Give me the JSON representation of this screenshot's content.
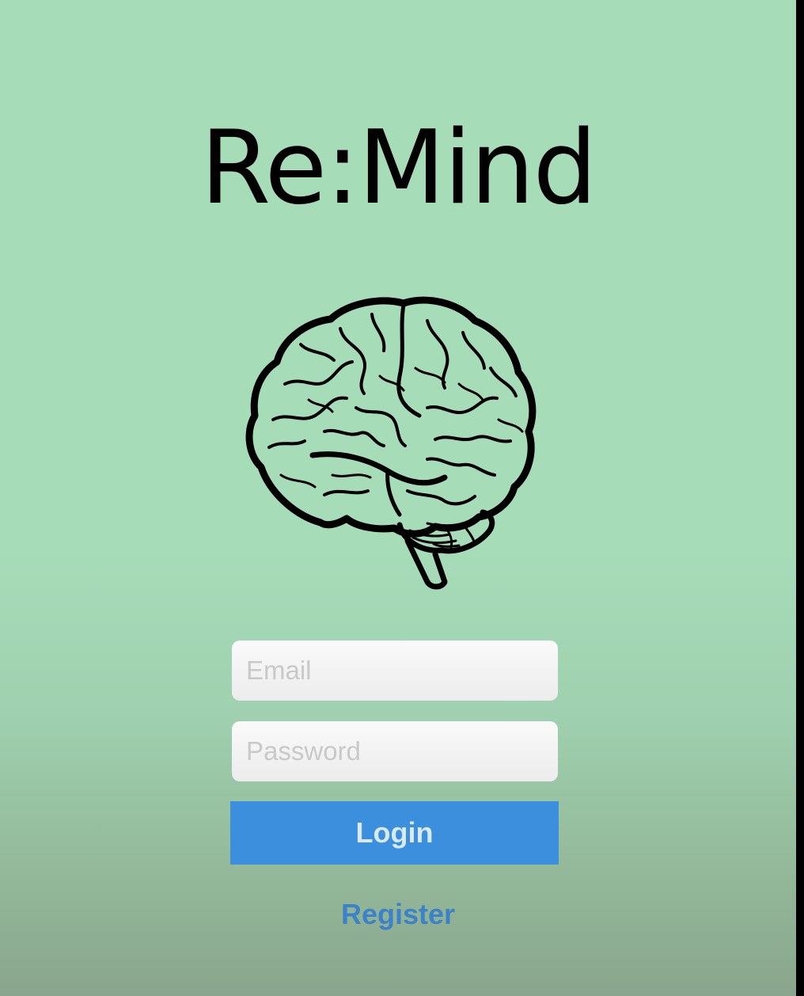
{
  "app": {
    "title": "Re:Mind"
  },
  "logo": {
    "icon": "brain-icon"
  },
  "login_form": {
    "email_placeholder": "Email",
    "email_value": "",
    "password_placeholder": "Password",
    "password_value": "",
    "login_label": "Login",
    "register_label": "Register"
  },
  "colors": {
    "background": "#a7dcb9",
    "button": "#3b8fdd",
    "link": "#3b82c8",
    "title": "#000000"
  }
}
